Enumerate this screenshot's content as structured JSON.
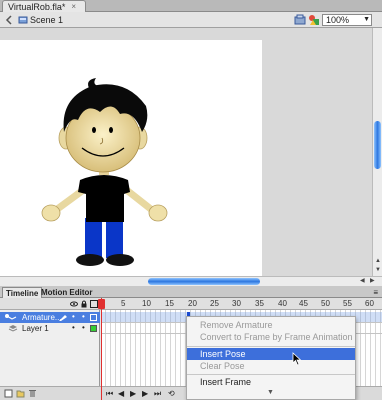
{
  "document": {
    "tab_title": "VirtualRob.fla*",
    "close": "×"
  },
  "scenebar": {
    "scene_label": "Scene 1",
    "zoom": "100%"
  },
  "panel": {
    "tabs": [
      "Timeline",
      "Motion Editor"
    ]
  },
  "timeline": {
    "ruler": [
      "5",
      "10",
      "15",
      "20",
      "25",
      "30",
      "35",
      "40",
      "45",
      "50",
      "55",
      "60"
    ],
    "layers": [
      {
        "name": "Armature..."
      },
      {
        "name": "Layer 1"
      }
    ],
    "current_frame": 1
  },
  "context_menu": {
    "items": [
      {
        "label": "Remove Armature",
        "enabled": false
      },
      {
        "label": "Convert to Frame by Frame Animation",
        "enabled": false
      },
      {
        "label": "Insert Pose",
        "enabled": true,
        "highlighted": true
      },
      {
        "label": "Clear Pose",
        "enabled": false
      },
      {
        "label": "Insert Frame",
        "enabled": true
      }
    ],
    "more_icon": "chevron-down-icon"
  },
  "colors": {
    "selection": "#3d6fdb",
    "scroll_thumb": "#2d77e0",
    "playhead": "#e03030"
  }
}
